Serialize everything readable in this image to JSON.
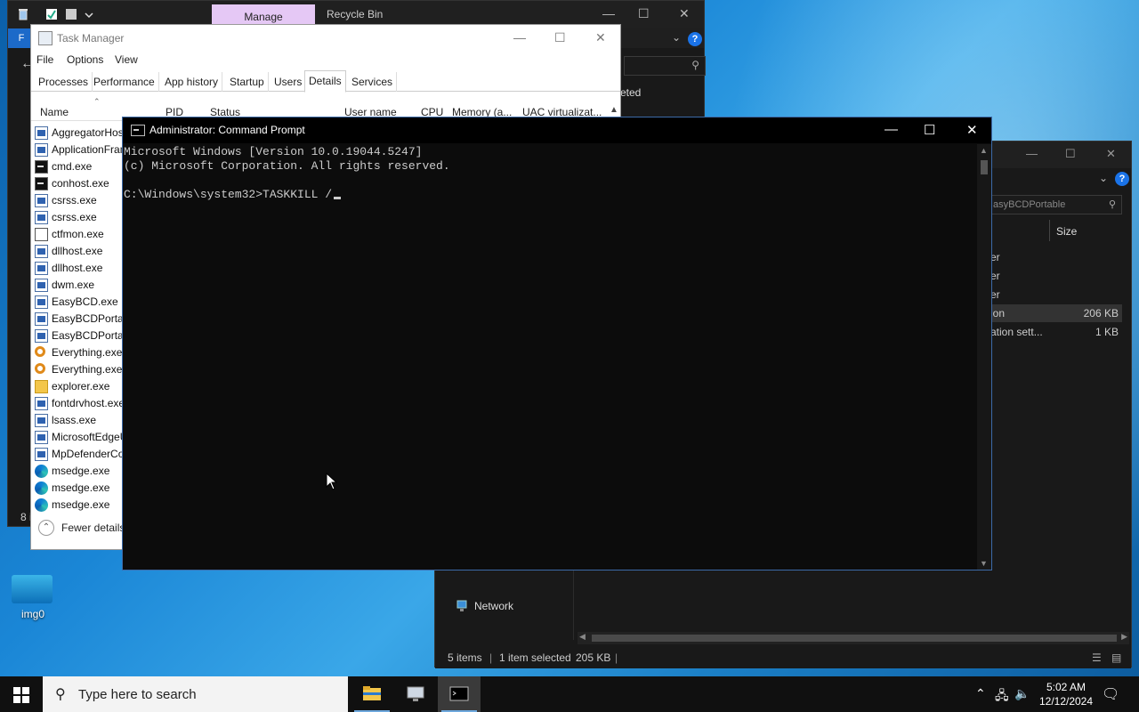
{
  "explorer_back": {
    "manage_tab": "Manage",
    "title": "Recycle Bin",
    "file_tab": "F",
    "deleted_snippet": "eted",
    "status_snippet": "8 i"
  },
  "explorer_right": {
    "search_placeholder": "asyBCDPortable",
    "size_header": "Size",
    "rows": [
      {
        "name": "er",
        "size": ""
      },
      {
        "name": "er",
        "size": ""
      },
      {
        "name": "er",
        "size": ""
      },
      {
        "name": "ion",
        "size": "206 KB"
      },
      {
        "name": "ation sett...",
        "size": "1 KB"
      }
    ],
    "nav_network": "Network",
    "status_items": "5 items",
    "status_selected": "1 item selected",
    "status_size": "205 KB"
  },
  "task_manager": {
    "title": "Task Manager",
    "menu": [
      "File",
      "Options",
      "View"
    ],
    "tabs": [
      "Processes",
      "Performance",
      "App history",
      "Startup",
      "Users",
      "Details",
      "Services"
    ],
    "active_tab": "Details",
    "columns": [
      "Name",
      "PID",
      "Status",
      "User name",
      "CPU",
      "Memory (a...",
      "UAC virtualizat..."
    ],
    "processes": [
      {
        "name": "AggregatorHost.exe",
        "icon": "generic"
      },
      {
        "name": "ApplicationFrameHost.exe",
        "icon": "generic"
      },
      {
        "name": "cmd.exe",
        "icon": "cmd"
      },
      {
        "name": "conhost.exe",
        "icon": "cmd"
      },
      {
        "name": "csrss.exe",
        "icon": "generic"
      },
      {
        "name": "csrss.exe",
        "icon": "generic"
      },
      {
        "name": "ctfmon.exe",
        "icon": "note"
      },
      {
        "name": "dllhost.exe",
        "icon": "generic"
      },
      {
        "name": "dllhost.exe",
        "icon": "generic"
      },
      {
        "name": "dwm.exe",
        "icon": "generic"
      },
      {
        "name": "EasyBCD.exe",
        "icon": "generic"
      },
      {
        "name": "EasyBCDPortable.exe",
        "icon": "generic"
      },
      {
        "name": "EasyBCDPortable.exe",
        "icon": "generic"
      },
      {
        "name": "Everything.exe",
        "icon": "search"
      },
      {
        "name": "Everything.exe",
        "icon": "search"
      },
      {
        "name": "explorer.exe",
        "icon": "folder"
      },
      {
        "name": "fontdrvhost.exe",
        "icon": "generic"
      },
      {
        "name": "lsass.exe",
        "icon": "generic"
      },
      {
        "name": "MicrosoftEdgeUpdate.exe",
        "icon": "generic"
      },
      {
        "name": "MpDefenderCoreService.exe",
        "icon": "generic"
      },
      {
        "name": "msedge.exe",
        "icon": "edge"
      },
      {
        "name": "msedge.exe",
        "icon": "edge"
      },
      {
        "name": "msedge.exe",
        "icon": "edge"
      }
    ],
    "fewer_details": "Fewer details"
  },
  "cmd": {
    "title": "Administrator: Command Prompt",
    "line1": "Microsoft Windows [Version 10.0.19044.5247]",
    "line2": "(c) Microsoft Corporation. All rights reserved.",
    "prompt": "C:\\Windows\\system32>TASKKILL /"
  },
  "desktop": {
    "icon_label": "img0"
  },
  "taskbar": {
    "search_placeholder": "Type here to search",
    "time": "5:02 AM",
    "date": "12/12/2024",
    "apps": [
      "file-explorer",
      "network-tool",
      "command-prompt"
    ],
    "active_app": "command-prompt"
  },
  "colors": {
    "accent": "#0078d4",
    "manage_tab": "#e5c8f5",
    "cmd_bg": "#0c0c0c",
    "cmd_text": "#cccccc"
  }
}
